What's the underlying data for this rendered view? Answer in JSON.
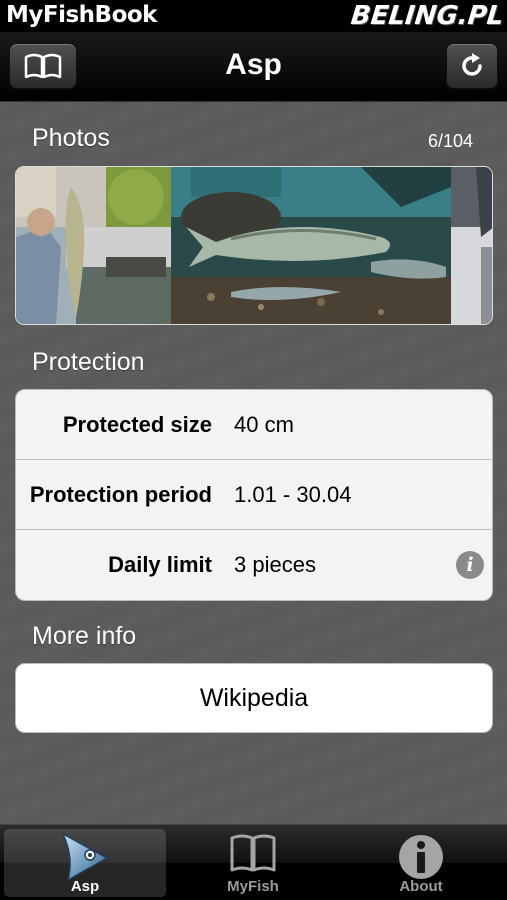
{
  "watermark": {
    "app_name": "MyFishBook",
    "brand": "BELING.PL"
  },
  "navbar": {
    "title": "Asp",
    "left_icon": "book-icon",
    "right_icon": "refresh-icon"
  },
  "photos": {
    "header": "Photos",
    "counter": "6/104"
  },
  "protection": {
    "header": "Protection",
    "rows": [
      {
        "label": "Protected size",
        "value": "40 cm"
      },
      {
        "label": "Protection period",
        "value": "1.01 - 30.04"
      },
      {
        "label": "Daily limit",
        "value": "3 pieces",
        "icon": "info-icon"
      }
    ]
  },
  "more_info": {
    "header": "More info",
    "link_label": "Wikipedia"
  },
  "tabbar": {
    "tabs": [
      {
        "label": "Asp",
        "icon": "fish-icon",
        "active": true
      },
      {
        "label": "MyFish",
        "icon": "book-icon",
        "active": false
      },
      {
        "label": "About",
        "icon": "info-icon",
        "active": false
      }
    ]
  },
  "colors": {
    "background": "#5c5c5c",
    "table_bg": "#f3f3f3",
    "text_light": "#ffffff"
  }
}
